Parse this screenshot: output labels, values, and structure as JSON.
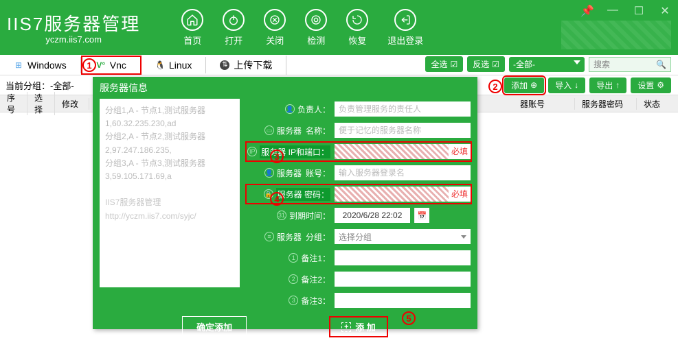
{
  "app": {
    "logo": "IIS7服务器管理",
    "logo_sub": "yczm.iis7.com"
  },
  "nav": {
    "home": "首页",
    "open": "打开",
    "close": "关闭",
    "detect": "检测",
    "restore": "恢复",
    "logout": "退出登录"
  },
  "tabs": {
    "windows": "Windows",
    "vnc": "Vnc",
    "linux": "Linux",
    "upload": "上传下载"
  },
  "toolbar": {
    "select_all": "全选",
    "invert_select": "反选",
    "all_option": "-全部-",
    "search_placeholder": "搜索"
  },
  "actions": {
    "current_group_label": "当前分组：",
    "current_group_value": "-全部-",
    "add": "添加",
    "import": "导入",
    "export": "导出",
    "settings": "设置"
  },
  "table_headers": {
    "seq": "序号",
    "select": "选择",
    "modify": "修改",
    "server_account": "器账号",
    "server_password": "服务器密码",
    "status": "状态"
  },
  "dialog": {
    "title": "服务器信息",
    "example_lines": [
      "分组1,A - 节点1,测试服务器1,60.32.235.230,ad",
      "分组2,A - 节点2,测试服务器2,97.247.186.235,",
      "分组3,A - 节点3,测试服务器3,59.105.171.69,a"
    ],
    "example_footer": "IIS7服务器管理 http://yczm.iis7.com/syjc/",
    "form": {
      "owner_label": "负责人：",
      "owner_placeholder": "负责管理服务的责任人",
      "name_label_prefix": "服务器",
      "name_label": "名称：",
      "name_placeholder": "便于记忆的服务器名称",
      "ip_label_prefix": "服务器",
      "ip_label": "IP和端口：",
      "ip_value": "",
      "account_label_prefix": "服务器",
      "account_label": "账号：",
      "account_placeholder": "输入服务器登录名",
      "password_label_prefix": "服务器",
      "password_label": "密码：",
      "password_value": "",
      "expire_label": "到期时间：",
      "expire_value": "2020/6/28 22:02",
      "group_label_prefix": "服务器",
      "group_label": "分组：",
      "group_placeholder": "选择分组",
      "note1_label": "备注1：",
      "note2_label": "备注2：",
      "note3_label": "备注3：",
      "required": "必填"
    },
    "confirm": "确定添加",
    "add_again": "添 加"
  },
  "markers": {
    "m1": "1",
    "m2": "2",
    "m3": "3",
    "m4": "4",
    "m5": "5"
  }
}
